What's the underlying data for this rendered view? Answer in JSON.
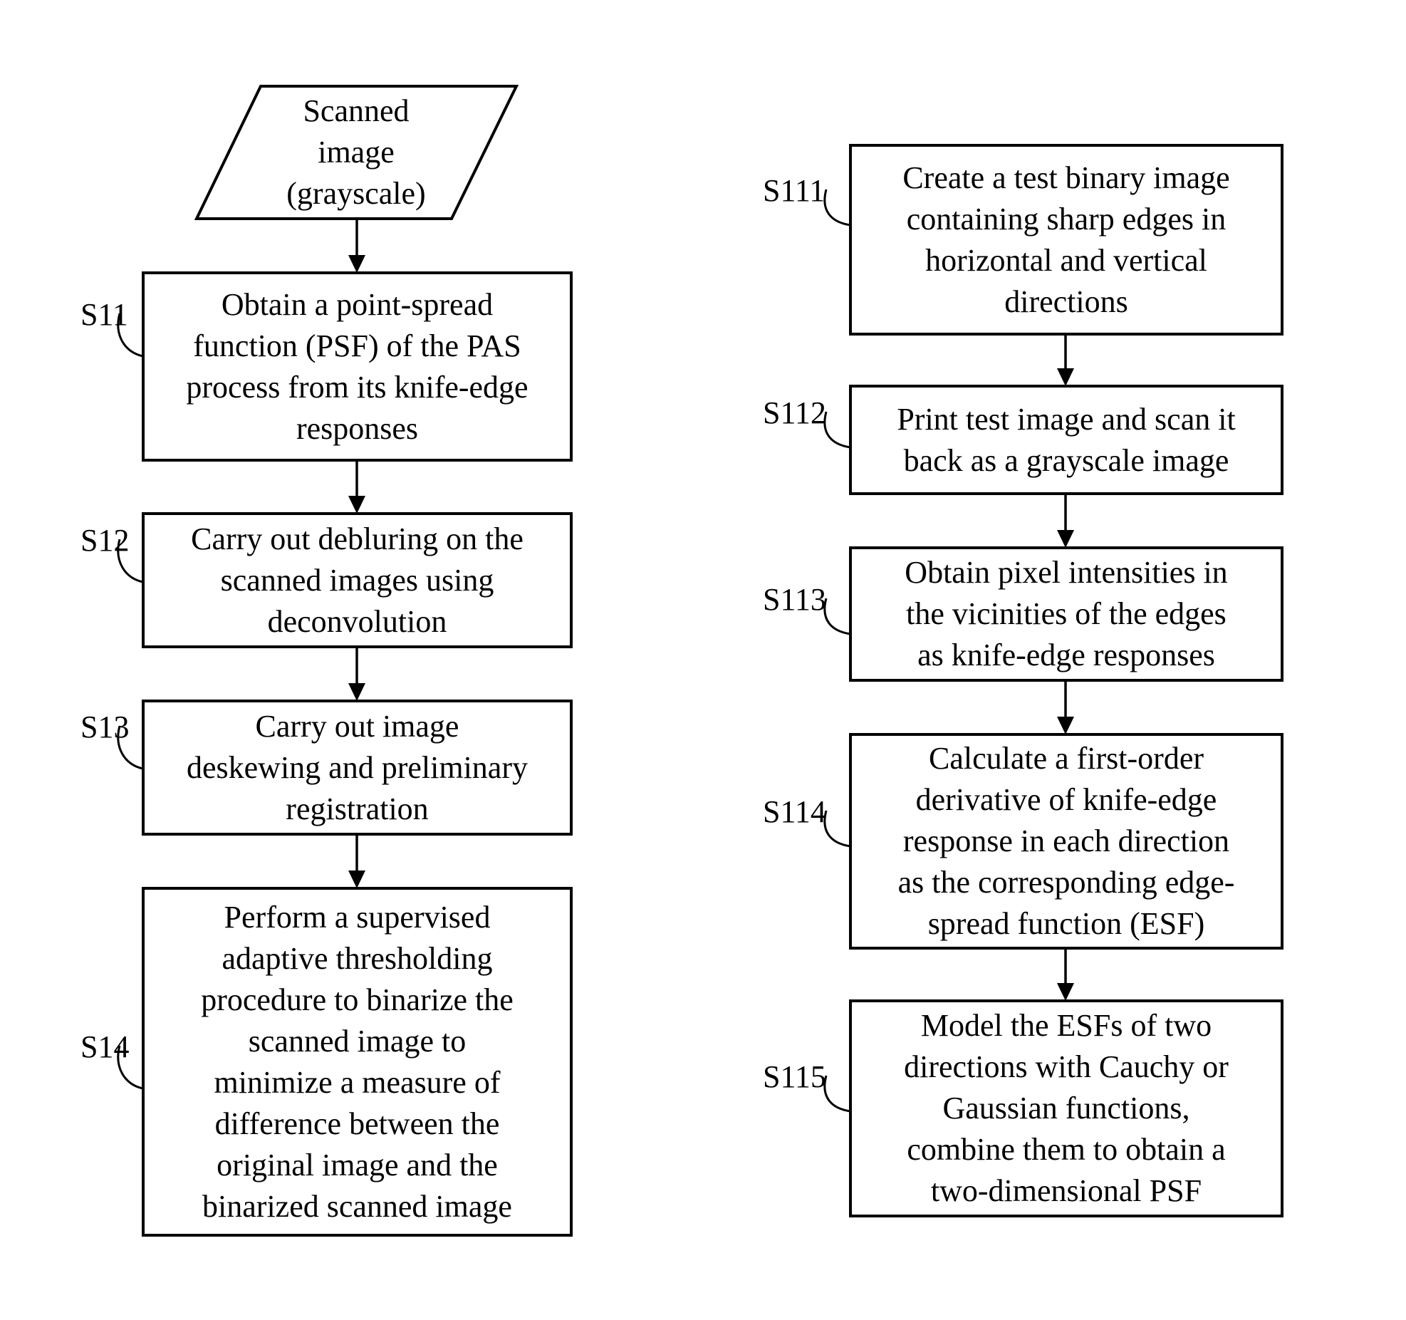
{
  "input": {
    "lines": [
      "Scanned",
      "image",
      "(grayscale)"
    ]
  },
  "left_steps": [
    {
      "id": "S11",
      "lines": [
        "Obtain a point-spread",
        "function (PSF) of the PAS",
        "process from its knife-edge",
        "responses"
      ]
    },
    {
      "id": "S12",
      "lines": [
        "Carry out debluring on the",
        "scanned images using",
        "deconvolution"
      ]
    },
    {
      "id": "S13",
      "lines": [
        "Carry out image",
        "deskewing and preliminary",
        "registration"
      ]
    },
    {
      "id": "S14",
      "lines": [
        "Perform a supervised",
        "adaptive thresholding",
        "procedure to binarize the",
        "scanned image to",
        "minimize a measure of",
        "difference between the",
        "original image and the",
        "binarized scanned image"
      ]
    }
  ],
  "right_steps": [
    {
      "id": "S111",
      "lines": [
        "Create a test binary image",
        "containing sharp edges in",
        "horizontal and vertical",
        "directions"
      ]
    },
    {
      "id": "S112",
      "lines": [
        "Print test image and scan it",
        "back as a grayscale image"
      ]
    },
    {
      "id": "S113",
      "lines": [
        "Obtain pixel intensities in",
        "the vicinities of the edges",
        "as knife-edge responses"
      ]
    },
    {
      "id": "S114",
      "lines": [
        "Calculate a first-order",
        "derivative of knife-edge",
        "response in each direction",
        "as the corresponding edge-",
        "spread function (ESF)"
      ]
    },
    {
      "id": "S115",
      "lines": [
        "Model the ESFs of two",
        "directions with Cauchy or",
        "Gaussian functions,",
        "combine them to obtain a",
        "two-dimensional PSF"
      ]
    }
  ]
}
